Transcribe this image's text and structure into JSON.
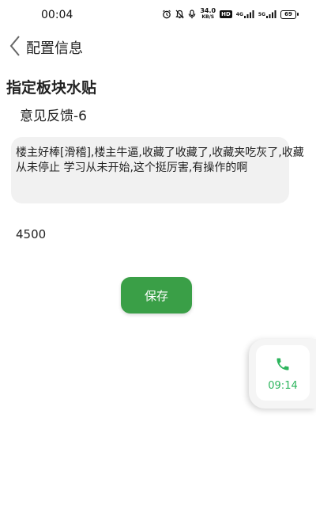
{
  "status_bar": {
    "time": "00:04",
    "net_speed_value": "34.0",
    "net_speed_unit": "KB/S",
    "hd_badge": "HD",
    "signal1_label": "4G",
    "signal2_label": "5G",
    "battery_level": "69"
  },
  "nav": {
    "title": "配置信息"
  },
  "page": {
    "section_title": "指定板块水贴",
    "item_title": "意见反馈-6",
    "content_text": "楼主好棒[滑稽],楼主牛逼,收藏了收藏了,收藏夹吃灰了,收藏从未停止 学习从未开始,这个挺厉害,有操作的啊",
    "value": "4500",
    "save_label": "保存"
  },
  "floating_call": {
    "duration": "09:14"
  },
  "colors": {
    "accent_green": "#3a9f47",
    "call_green": "#2db55d",
    "content_bg": "#f1f1f1"
  }
}
